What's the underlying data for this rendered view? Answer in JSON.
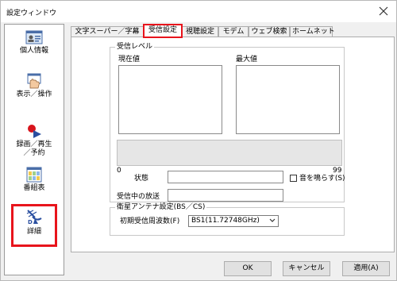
{
  "window": {
    "title": "設定ウィンドウ"
  },
  "sidebar": {
    "items": [
      {
        "label": "個人情報",
        "icon": "person-card-icon",
        "selected": false
      },
      {
        "label": "表示／操作",
        "icon": "hand-window-icon",
        "selected": false
      },
      {
        "label": "録画／再生\n／予約",
        "icon": "record-play-icon",
        "selected": false
      },
      {
        "label": "番組表",
        "icon": "grid-icon",
        "selected": false
      },
      {
        "label": "詳細",
        "icon": "satellite-dish-icon",
        "selected": true
      }
    ]
  },
  "tabs": [
    {
      "label": "文字スーパー／字幕",
      "active": false
    },
    {
      "label": "受信設定",
      "active": true
    },
    {
      "label": "視聴設定",
      "active": false
    },
    {
      "label": "モデム",
      "active": false
    },
    {
      "label": "ウェブ検索",
      "active": false
    },
    {
      "label": "ホームネット",
      "active": false
    }
  ],
  "reception": {
    "group_title": "受信レベル",
    "current_label": "現在値",
    "max_label": "最大値",
    "scale_min": "0",
    "scale_max": "99",
    "status_label": "状態",
    "sound_checkbox_label": "音を鳴らす(S)",
    "sound_checked": false,
    "broadcast_label": "受信中の放送"
  },
  "antenna": {
    "group_title": "衛星アンテナ設定(BS／CS)",
    "freq_label": "初期受信周波数(F)",
    "freq_value": "BS1(11.72748GHz)"
  },
  "buttons": {
    "ok": "OK",
    "cancel": "キャンセル",
    "apply": "適用(A)"
  },
  "colors": {
    "highlight": "#e8141c",
    "window_bg": "#f0f0f0",
    "level_bar": "#e6e6e6"
  }
}
